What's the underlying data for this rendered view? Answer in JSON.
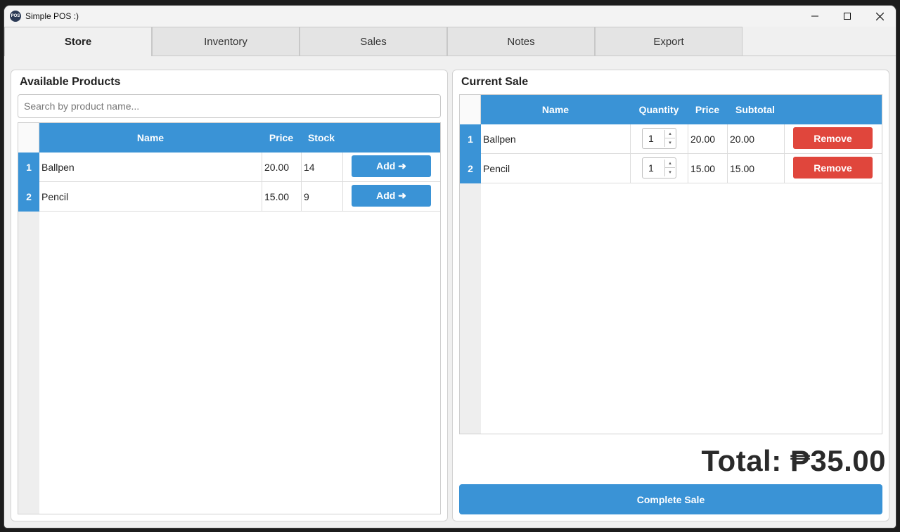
{
  "window": {
    "title": "Simple POS :)",
    "icon_text": "POS"
  },
  "tabs": [
    {
      "label": "Store",
      "active": true
    },
    {
      "label": "Inventory",
      "active": false
    },
    {
      "label": "Sales",
      "active": false
    },
    {
      "label": "Notes",
      "active": false
    },
    {
      "label": "Export",
      "active": false
    }
  ],
  "products": {
    "title": "Available Products",
    "search": {
      "placeholder": "Search by product name...",
      "value": ""
    },
    "columns": [
      "Name",
      "Price",
      "Stock"
    ],
    "rows": [
      {
        "num": "1",
        "name": "Ballpen",
        "price": "20.00",
        "stock": "14",
        "action": "Add ➜"
      },
      {
        "num": "2",
        "name": "Pencil",
        "price": "15.00",
        "stock": "9",
        "action": "Add ➜"
      }
    ]
  },
  "sale": {
    "title": "Current Sale",
    "columns": [
      "Name",
      "Quantity",
      "Price",
      "Subtotal"
    ],
    "rows": [
      {
        "num": "1",
        "name": "Ballpen",
        "quantity": "1",
        "price": "20.00",
        "subtotal": "20.00",
        "action": "Remove"
      },
      {
        "num": "2",
        "name": "Pencil",
        "quantity": "1",
        "price": "15.00",
        "subtotal": "15.00",
        "action": "Remove"
      }
    ],
    "total": "Total: ₱35.00",
    "complete_label": "Complete Sale"
  },
  "colors": {
    "accent": "#3a93d6",
    "danger": "#e0463c"
  },
  "icons": {
    "minimize": "minimize-icon",
    "maximize": "maximize-icon",
    "close": "close-icon",
    "arrow_right": "arrow-right-icon"
  }
}
